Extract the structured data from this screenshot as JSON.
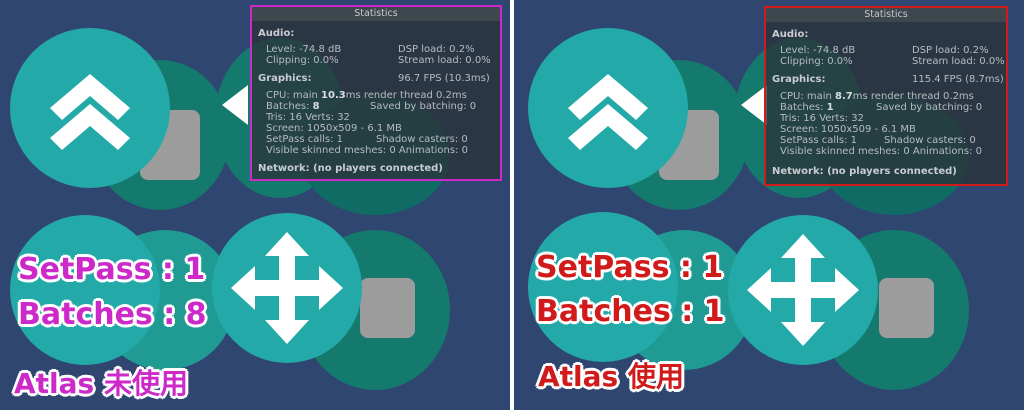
{
  "colors": {
    "accent_left": "#cc29c8",
    "accent_right": "#d11b1b",
    "background": "#2e4670"
  },
  "icons": [
    "chevron-double-up-icon",
    "move-arrows-icon"
  ],
  "left": {
    "stats": {
      "title": "Statistics",
      "audio_header": "Audio:",
      "level": "Level: -74.8 dB",
      "dsp_load": "DSP load: 0.2%",
      "clipping": "Clipping: 0.0%",
      "stream_load": "Stream load: 0.0%",
      "graphics_header": "Graphics:",
      "fps": "96.7 FPS (10.3ms)",
      "cpu_prefix": "CPU: main ",
      "cpu_main": "10.3",
      "cpu_suffix": "ms  render thread 0.2ms",
      "batches_prefix": "Batches: ",
      "batches_value": "8",
      "saved_by_batching": "Saved by batching: 0",
      "tris_verts": "Tris: 16    Verts: 32",
      "screen": "Screen: 1050x509 - 6.1 MB",
      "setpass_calls": "SetPass calls: 1",
      "shadow_casters": "Shadow casters: 0",
      "visible_skinned": "Visible skinned meshes: 0  Animations: 0",
      "network": "Network: (no players connected)"
    },
    "overlay": {
      "setpass": "SetPass : 1",
      "batches": "Batches : 8",
      "atlas": "Atlas 未使用"
    }
  },
  "right": {
    "stats": {
      "title": "Statistics",
      "audio_header": "Audio:",
      "level": "Level: -74.8 dB",
      "dsp_load": "DSP load: 0.2%",
      "clipping": "Clipping: 0.0%",
      "stream_load": "Stream load: 0.0%",
      "graphics_header": "Graphics:",
      "fps": "115.4 FPS (8.7ms)",
      "cpu_prefix": "CPU: main ",
      "cpu_main": "8.7",
      "cpu_suffix": "ms  render thread 0.2ms",
      "batches_prefix": "Batches: ",
      "batches_value": "1",
      "saved_by_batching": "Saved by batching: 0",
      "tris_verts": "Tris: 16    Verts: 32",
      "screen": "Screen: 1050x509 - 6.1 MB",
      "setpass_calls": "SetPass calls: 1",
      "shadow_casters": "Shadow casters: 0",
      "visible_skinned": "Visible skinned meshes: 0  Animations: 0",
      "network": "Network: (no players connected)"
    },
    "overlay": {
      "setpass": "SetPass : 1",
      "batches": "Batches : 1",
      "atlas": "Atlas 使用"
    }
  }
}
